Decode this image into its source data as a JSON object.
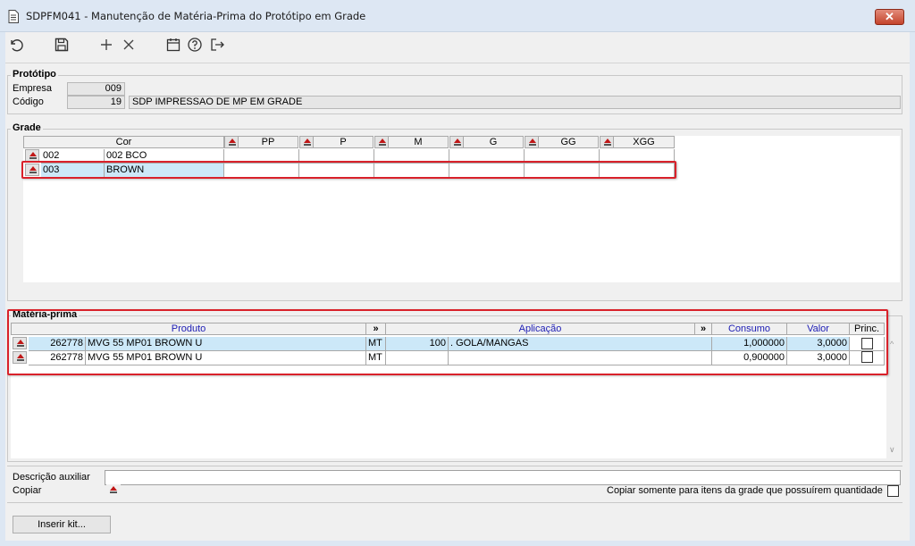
{
  "window": {
    "title": "SDPFM041 - Manutenção de Matéria-Prima do Protótipo em Grade",
    "close_glyph": "✕"
  },
  "toolbar": {
    "icons": [
      "undo-icon",
      "save-icon",
      "add-icon",
      "delete-icon",
      "calendar-icon",
      "help-icon",
      "exit-icon"
    ]
  },
  "prototipo": {
    "title": "Protótipo",
    "empresa_label": "Empresa",
    "empresa_value": "009",
    "codigo_label": "Código",
    "codigo_value": "19",
    "descricao_value": "SDP IMPRESSAO DE MP EM GRADE"
  },
  "grade": {
    "title": "Grade",
    "cor_header": "Cor",
    "sizes": [
      "PP",
      "P",
      "M",
      "G",
      "GG",
      "XGG"
    ],
    "rows": [
      {
        "code": "002",
        "name": "002 BCO"
      },
      {
        "code": "003",
        "name": "BROWN"
      }
    ]
  },
  "materia_prima": {
    "title": "Matéria-prima",
    "headers": {
      "produto": "Produto",
      "expand1": "»",
      "aplicacao": "Aplicação",
      "expand2": "»",
      "consumo": "Consumo",
      "valor": "Valor",
      "princ": "Princ."
    },
    "rows": [
      {
        "code": "262778",
        "descricao": "MVG 55 MP01 BROWN U",
        "unidade": "MT",
        "aplic_code": "100",
        "aplic_desc": ". GOLA/MANGAS",
        "consumo": "1,000000",
        "valor": "3,0000",
        "princ": false
      },
      {
        "code": "262778",
        "descricao": "MVG 55 MP01 BROWN U",
        "unidade": "MT",
        "aplic_code": "",
        "aplic_desc": "",
        "consumo": "0,900000",
        "valor": "3,0000",
        "princ": false
      }
    ]
  },
  "footer": {
    "descricao_label": "Descrição auxiliar",
    "copiar_label": "Copiar",
    "copiar_somente_label": "Copiar somente para itens da grade que possuírem quantidade",
    "inserir_kit_label": "Inserir kit..."
  },
  "colors": {
    "highlight": "#d9212a",
    "row_selected": "#cce8f8",
    "header_blue": "#1c1cb4"
  }
}
